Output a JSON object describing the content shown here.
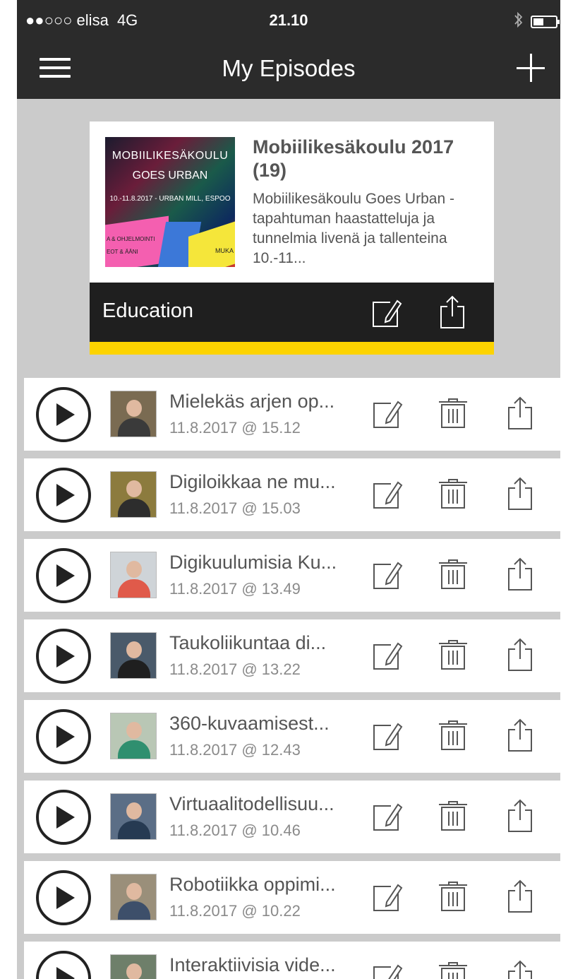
{
  "status_bar": {
    "carrier": "●●○○○ elisa",
    "network": "4G",
    "time": "21.10",
    "bluetooth_icon": "bluetooth-icon",
    "battery_level": 0.45
  },
  "nav": {
    "title": "My Episodes",
    "menu_icon": "hamburger-icon",
    "add_icon": "plus-icon"
  },
  "podcast": {
    "title": "Mobiilikesäkoulu 2017 (19)",
    "description": "Mobiilikesäkoulu Goes Urban -tapahtuman haastatteluja ja tunnelmia livenä ja tallenteina 10.-11...",
    "category": "Education",
    "cover": {
      "line1": "MOBIILIKESÄKOULU",
      "line2": "GOES URBAN",
      "line3": "10.-11.8.2017 - URBAN MILL, ESPOO",
      "line4": "A & OHJELMOINTI",
      "line5": "EOT & ÄÄNI",
      "line6": "MUKA"
    },
    "accent_color": "#fcd300"
  },
  "episodes": [
    {
      "title": "Mielekäs arjen op...",
      "date": "11.8.2017 @ 15.12"
    },
    {
      "title": "Digiloikkaa ne mu...",
      "date": "11.8.2017 @ 15.03"
    },
    {
      "title": "Digikuulumisia Ku...",
      "date": "11.8.2017 @ 13.49"
    },
    {
      "title": "Taukoliikuntaa di...",
      "date": "11.8.2017 @ 13.22"
    },
    {
      "title": "360-kuvaamisest...",
      "date": "11.8.2017 @ 12.43"
    },
    {
      "title": "Virtuaalitodellisuu...",
      "date": "11.8.2017 @ 10.46"
    },
    {
      "title": "Robotiikka oppimi...",
      "date": "11.8.2017 @ 10.22"
    },
    {
      "title": "Interaktiivisia vide...",
      "date": ""
    }
  ]
}
